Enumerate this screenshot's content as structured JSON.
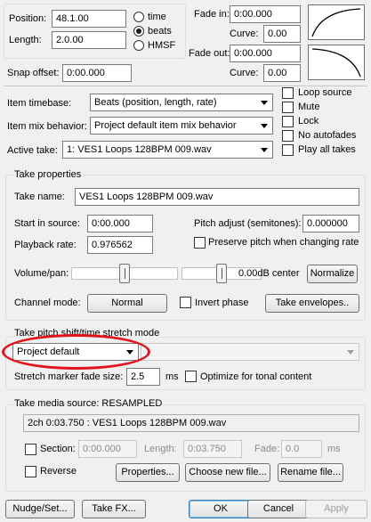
{
  "position": {
    "label": "Position:",
    "value": "48.1.00"
  },
  "length": {
    "label": "Length:",
    "value": "2.0.00"
  },
  "time_format": {
    "options": [
      "time",
      "beats",
      "HMSF"
    ],
    "selected": "beats"
  },
  "fade_in": {
    "label": "Fade in:",
    "value": "0:00.000",
    "curve_label": "Curve:",
    "curve_value": "0.00"
  },
  "fade_out": {
    "label": "Fade out:",
    "value": "0:00.000",
    "curve_label": "Curve:",
    "curve_value": "0.00"
  },
  "snap_offset": {
    "label": "Snap offset:",
    "value": "0:00.000"
  },
  "item_timebase": {
    "label": "Item timebase:",
    "value": "Beats (position, length, rate)"
  },
  "item_mix": {
    "label": "Item mix behavior:",
    "value": "Project default item mix behavior"
  },
  "active_take": {
    "label": "Active take:",
    "value": "1: VES1 Loops 128BPM 009.wav"
  },
  "flags": [
    {
      "label": "Loop source",
      "checked": false
    },
    {
      "label": "Mute",
      "checked": false
    },
    {
      "label": "Lock",
      "checked": false
    },
    {
      "label": "No autofades",
      "checked": false
    },
    {
      "label": "Play all takes",
      "checked": false
    }
  ],
  "take_properties": {
    "title": "Take properties",
    "take_name_label": "Take name:",
    "take_name": "VES1 Loops 128BPM 009.wav",
    "start_label": "Start in source:",
    "start_value": "0:00.000",
    "pitch_label": "Pitch adjust (semitones):",
    "pitch_value": "0.000000",
    "rate_label": "Playback rate:",
    "rate_value": "0.976562",
    "preserve_label": "Preserve pitch when changing rate",
    "volpan_label": "Volume/pan:",
    "volpan_value": "0.00dB center",
    "volume_level": 0.5,
    "pan_level": 0.5,
    "normalize_label": "Normalize",
    "channel_mode_label": "Channel mode:",
    "channel_mode_value": "Normal",
    "invert_label": "Invert phase",
    "envelopes_label": "Take envelopes.."
  },
  "pitch_mode": {
    "title": "Take pitch shift/time stretch mode",
    "mode_value": "Project default",
    "fade_size_label": "Stretch marker fade size:",
    "fade_size_value": "2.5",
    "fade_size_unit": "ms",
    "optimize_label": "Optimize for tonal content"
  },
  "media_source": {
    "title": "Take media source:  RESAMPLED",
    "source_value": "2ch 0:03.750 : VES1 Loops 128BPM 009.wav",
    "section_label": "Section:",
    "section_start": "0:00.000",
    "section_length_label": "Length:",
    "section_length": "0:03.750",
    "section_fade_label": "Fade:",
    "section_fade": "0.0",
    "section_fade_unit": "ms",
    "reverse_label": "Reverse",
    "properties_label": "Properties...",
    "choose_file_label": "Choose new file...",
    "rename_file_label": "Rename file..."
  },
  "footer": {
    "nudge_label": "Nudge/Set...",
    "take_fx_label": "Take FX...",
    "ok_label": "OK",
    "cancel_label": "Cancel",
    "apply_label": "Apply"
  },
  "colors": {
    "annotation": "#e0141a",
    "background": "#f0f0f0"
  }
}
